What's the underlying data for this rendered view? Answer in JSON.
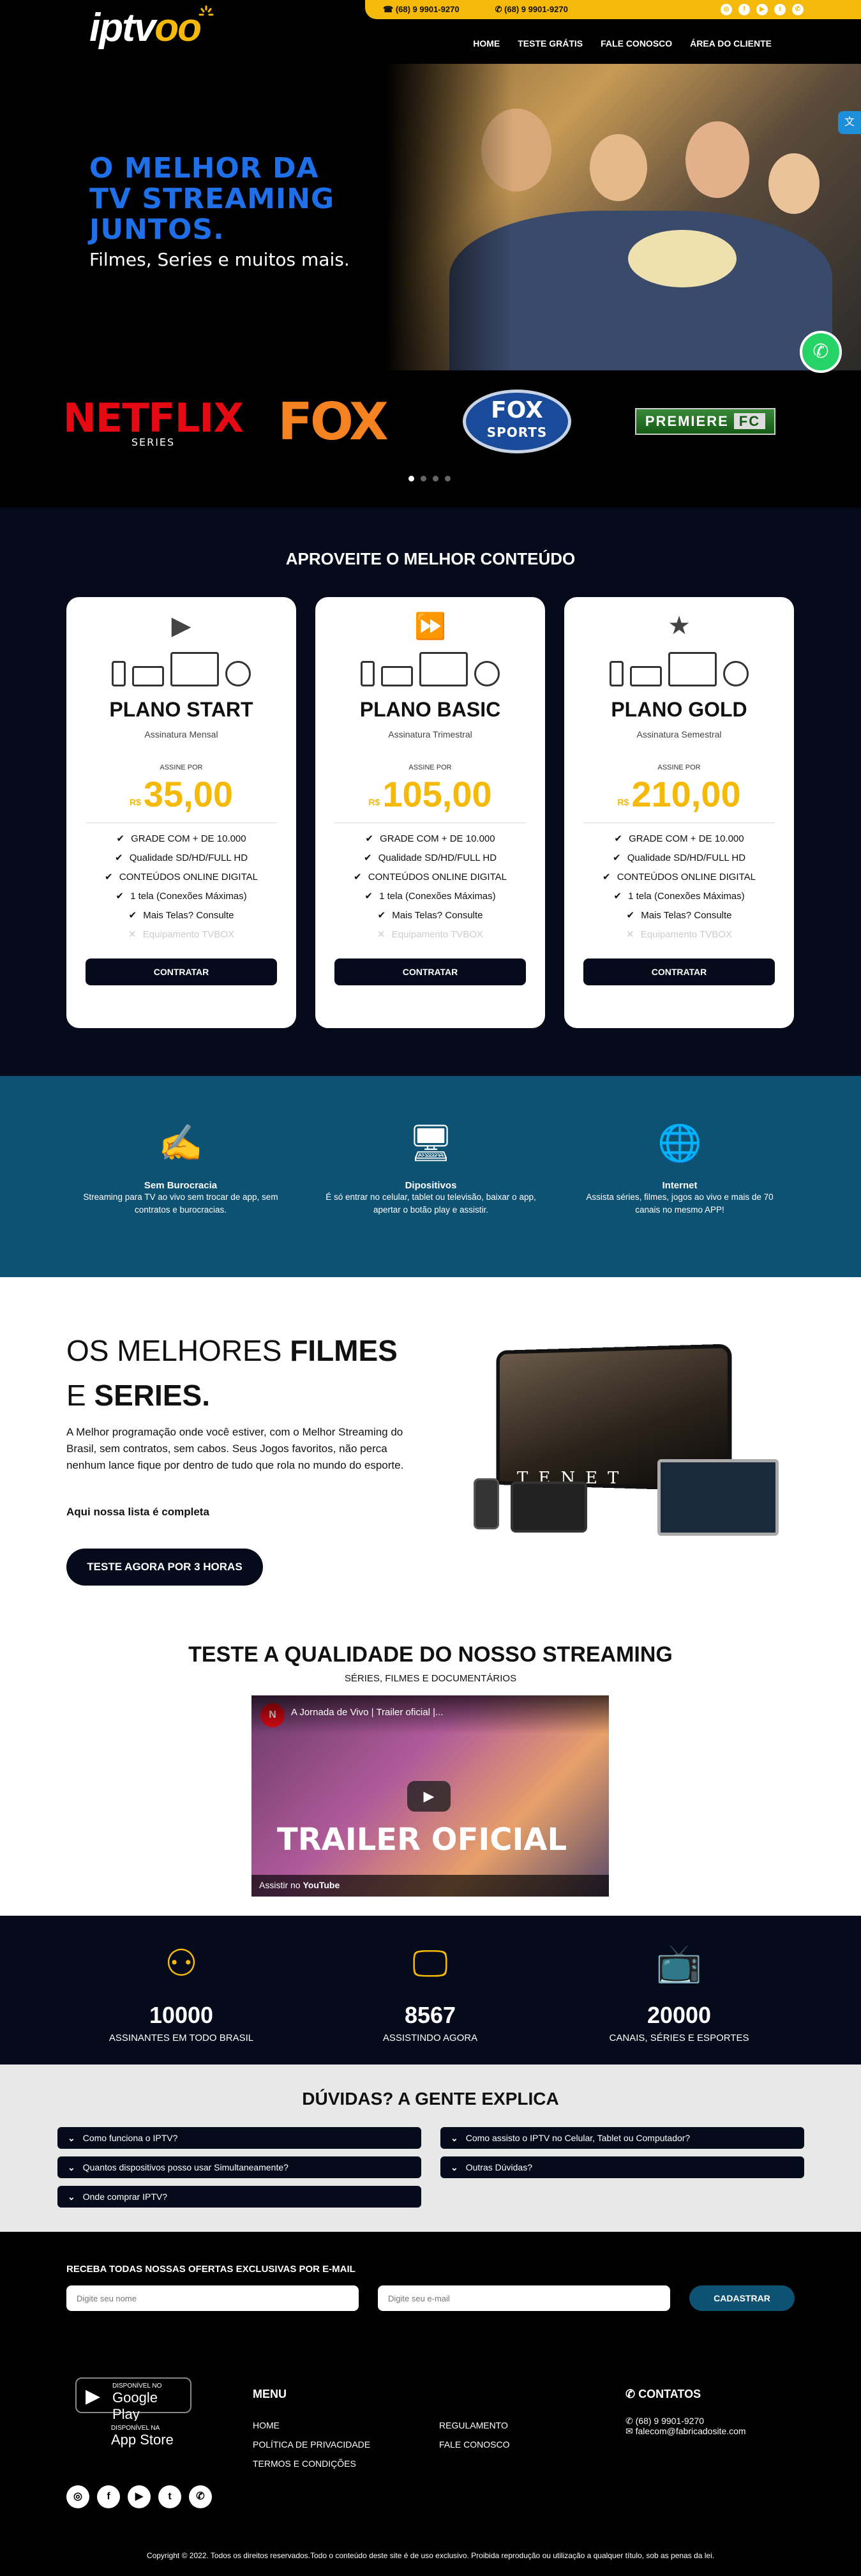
{
  "header": {
    "logo": "iptv",
    "logo_oo": "oo",
    "phone": "(68) 9 9901-9270",
    "whatsapp": "(68) 9 9901-9270",
    "nav": [
      "HOME",
      "TESTE GRÁTIS",
      "FALE CONOSCO",
      "ÁREA DO CLIENTE"
    ]
  },
  "hero": {
    "title_l1": "O MELHOR DA",
    "title_l2": "TV STREAMING",
    "title_l3": "JUNTOS.",
    "subtitle": "Filmes, Series e muitos mais."
  },
  "brands": {
    "netflix": "NETFLIX",
    "netflix_sub": "SERIES",
    "fox": "FOX",
    "fox_sports_1": "FOX",
    "fox_sports_2": "SPORTS",
    "premiere_1": "PREMIERE",
    "premiere_2": "FC"
  },
  "plans": {
    "title": "APROVEITE O MELHOR CONTEÚDO",
    "cards": [
      {
        "name": "PLANO START",
        "period": "Assinatura Mensal",
        "assine": "ASSINE POR",
        "currency": "R$",
        "price": "35,00",
        "icon": "play-icon"
      },
      {
        "name": "PLANO BASIC",
        "period": "Assinatura Trimestral",
        "assine": "ASSINE POR",
        "currency": "R$",
        "price": "105,00",
        "icon": "fast-forward-icon"
      },
      {
        "name": "PLANO GOLD",
        "period": "Assinatura Semestral",
        "assine": "ASSINE POR",
        "currency": "R$",
        "price": "210,00",
        "icon": "star-icon"
      }
    ],
    "features": [
      "GRADE COM + DE 10.000",
      "Qualidade SD/HD/FULL HD",
      "CONTEÚDOS ONLINE DIGITAL",
      "1 tela (Conexões Máximas)",
      "Mais Telas? Consulte",
      "Equipamento TVBOX"
    ],
    "button": "CONTRATAR"
  },
  "benefits": [
    {
      "title": "Sem Burocracia",
      "text": "Streaming para TV ao vivo sem trocar de app, sem contratos e burocracias."
    },
    {
      "title": "Dipositivos",
      "text": "É só entrar no celular, tablet ou televisão, baixar o app, apertar o botão play e assistir."
    },
    {
      "title": "Internet",
      "text": "Assista séries, filmes, jogos ao vivo e mais de 70 canais no mesmo APP!"
    }
  ],
  "movies": {
    "h_light1": "OS MELHORES ",
    "h_bold1": "FILMES",
    "h_light2": "E ",
    "h_bold2": "SERIES.",
    "desc": "A Melhor programação onde você estiver, com o Melhor Streaming do Brasil, sem contratos, sem cabos. Seus Jogos favoritos, não perca nenhum lance fique por dentro de tudo que rola no mundo do esporte.",
    "list": "Aqui nossa lista é completa",
    "button": "TESTE AGORA POR 3 HORAS",
    "tv_text": "TENET",
    "test_title": "TESTE A QUALIDADE DO NOSSO STREAMING",
    "test_sub": "SÉRIES, FILMES E DOCUMENTÁRIOS",
    "video_title": "A Jornada de Vivo | Trailer oficial |...",
    "video_big": "TRAILER OFICIAL",
    "video_watch": "Assistir no",
    "video_yt": "YouTube"
  },
  "stats": [
    {
      "n": "10000",
      "c": "ASSINANTES EM TODO BRASIL"
    },
    {
      "n": "8567",
      "c": "ASSISTINDO AGORA"
    },
    {
      "n": "20000",
      "c": "CANAIS, SÉRIES E ESPORTES"
    }
  ],
  "faq": {
    "title": "DÚVIDAS? A GENTE EXPLICA",
    "items": [
      "Como funciona o IPTV?",
      "Como assisto o IPTV no Celular, Tablet ou Computador?",
      "Quantos dispositivos posso usar Simultaneamente?",
      "Outras Dúvidas?",
      "Onde comprar IPTV?"
    ]
  },
  "newsletter": {
    "title": "RECEBA TODAS NOSSAS OFERTAS EXCLUSIVAS POR E-MAIL",
    "name_ph": "Digite seu nome",
    "email_ph": "Digite seu e-mail",
    "button": "CADASTRAR"
  },
  "footer": {
    "gp_small": "DISPONÍVEL NO",
    "gp": "Google Play",
    "as_small": "DISPONÍVEL NA",
    "as": "App Store",
    "menu": "MENU",
    "links1": [
      "HOME",
      "POLÍTICA DE PRIVACIDADE",
      "TERMOS E CONDIÇÕES"
    ],
    "links2": [
      "REGULAMENTO",
      "FALE CONOSCO"
    ],
    "contacts": "CONTATOS",
    "phone": "(68) 9 9901-9270",
    "email": "falecom@fabricadosite.com",
    "copyright": "Copyright © 2022. Todos os direitos reservados.Todo o conteúdo deste site é de uso exclusivo. Proibida reprodução ou utilização a qualquer título, sob as penas da lei."
  },
  "colors": {
    "accent": "#f5b90a",
    "dark": "#050b1a",
    "teal": "#0e5273",
    "blue": "#1f6fe8"
  }
}
